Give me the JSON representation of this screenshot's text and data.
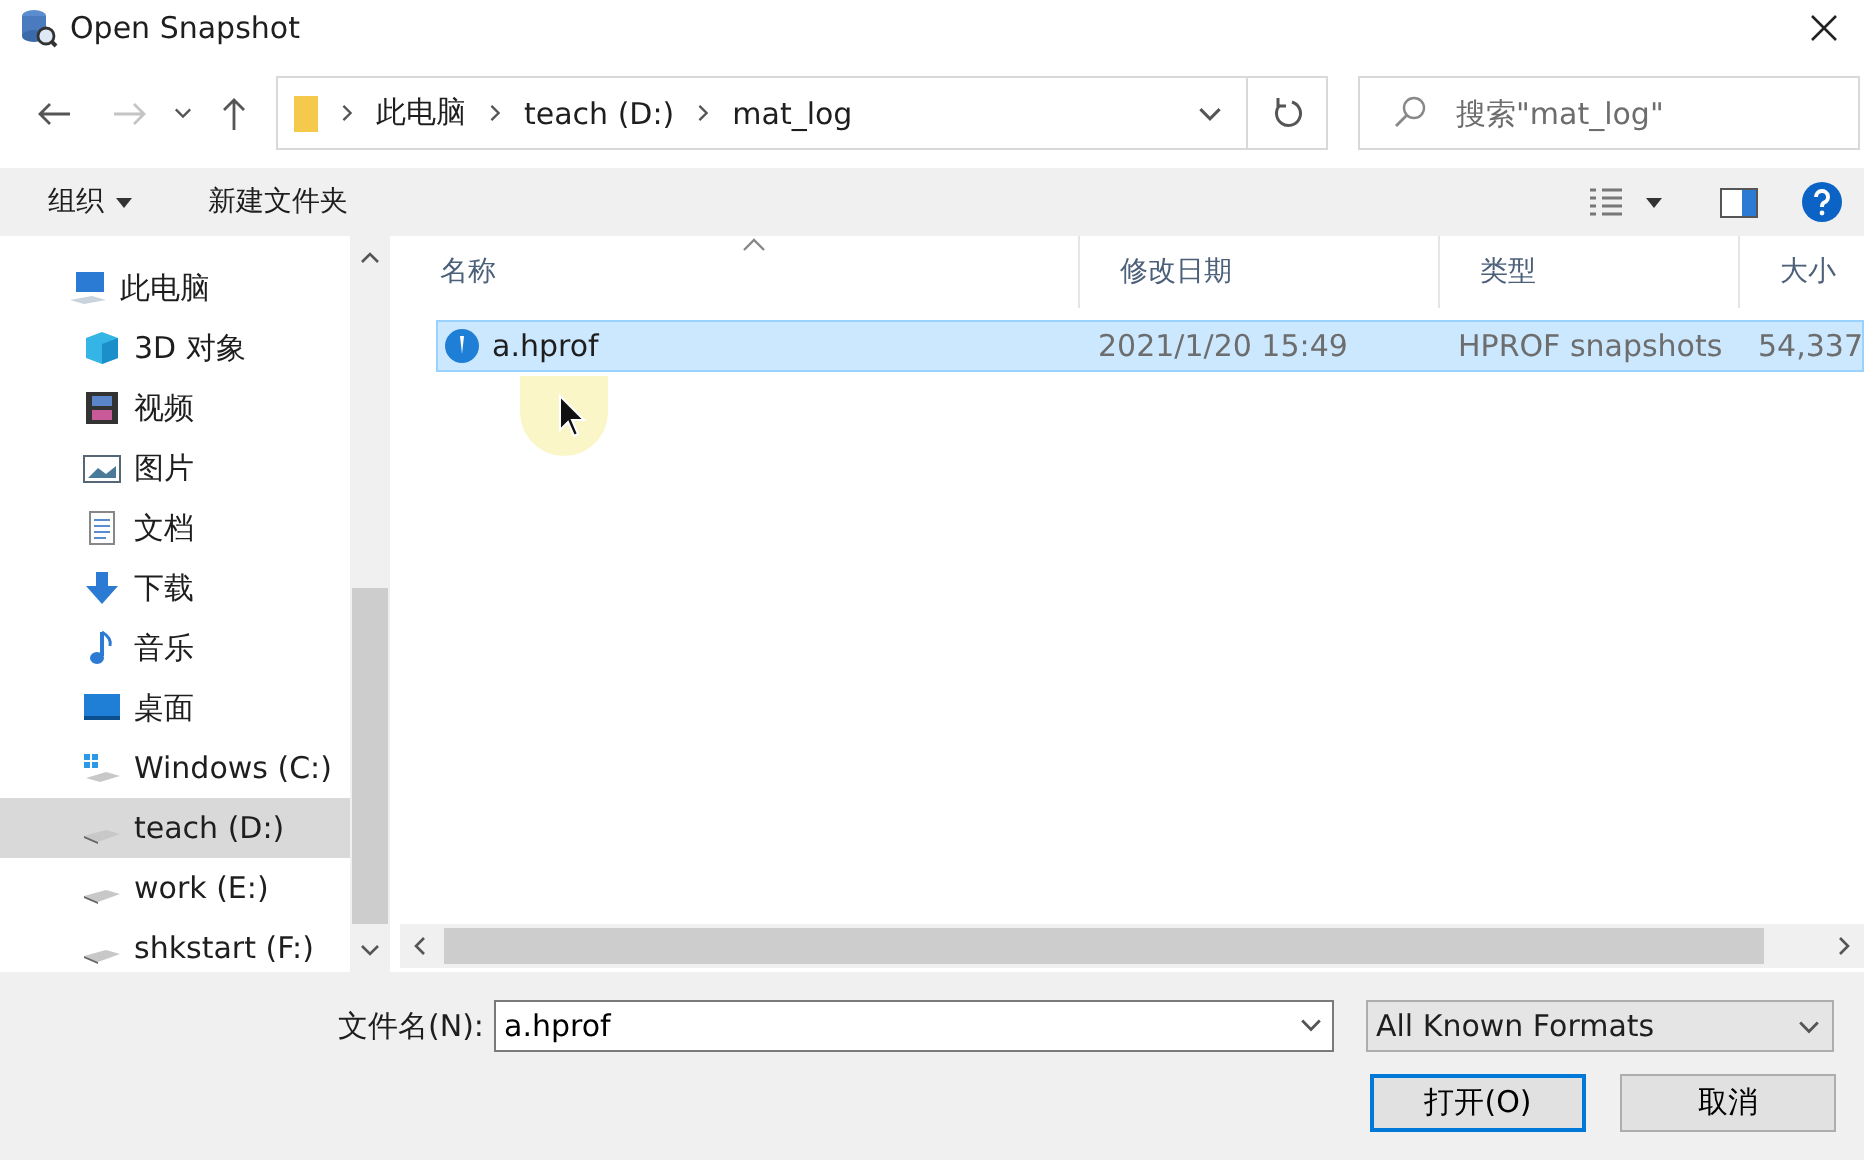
{
  "window": {
    "title": "Open Snapshot"
  },
  "breadcrumb": [
    "此电脑",
    "teach (D:)",
    "mat_log"
  ],
  "search": {
    "placeholder": "搜索\"mat_log\""
  },
  "toolbar": {
    "organize": "组织",
    "new_folder": "新建文件夹"
  },
  "sidebar": {
    "items": [
      {
        "kind": "pc",
        "label": "此电脑",
        "selected": false,
        "children": [
          {
            "kind": "cube",
            "label": "3D 对象",
            "selected": false
          },
          {
            "kind": "video",
            "label": "视频",
            "selected": false
          },
          {
            "kind": "picture",
            "label": "图片",
            "selected": false
          },
          {
            "kind": "doc",
            "label": "文档",
            "selected": false
          },
          {
            "kind": "download",
            "label": "下载",
            "selected": false
          },
          {
            "kind": "music",
            "label": "音乐",
            "selected": false
          },
          {
            "kind": "desktop",
            "label": "桌面",
            "selected": false
          },
          {
            "kind": "windrive",
            "label": "Windows (C:)",
            "selected": false
          },
          {
            "kind": "drive",
            "label": "teach (D:)",
            "selected": true
          },
          {
            "kind": "drive",
            "label": "work (E:)",
            "selected": false
          },
          {
            "kind": "drive",
            "label": "shkstart (F:)",
            "selected": false
          }
        ]
      }
    ]
  },
  "table": {
    "columns": [
      "名称",
      "修改日期",
      "类型",
      "大小"
    ],
    "rows": [
      {
        "cells": [
          "a.hprof",
          "2021/1/20 15:49",
          "HPROF snapshots",
          "54,337"
        ],
        "selected": true
      }
    ]
  },
  "footer": {
    "filename_label": "文件名(N):",
    "filename": "a.hprof",
    "filter": "All Known Formats",
    "buttons": [
      "打开(O)",
      "取消"
    ]
  }
}
